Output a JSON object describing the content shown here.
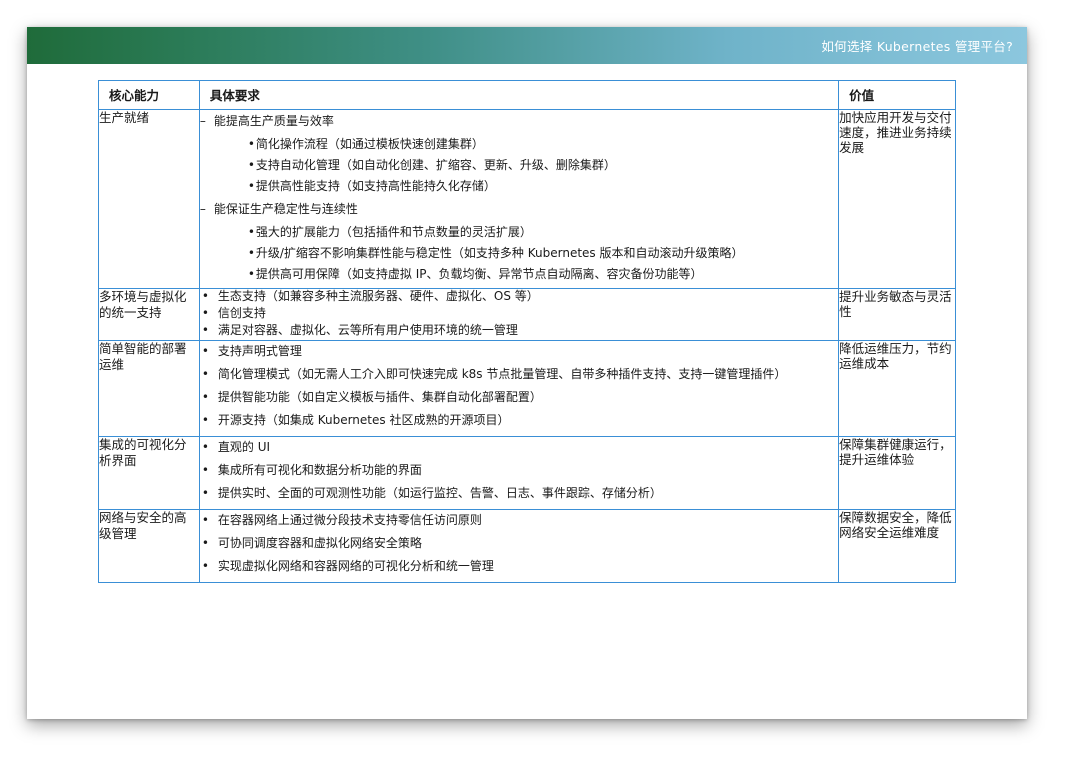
{
  "header": {
    "title": "如何选择 Kubernetes 管理平台?"
  },
  "table": {
    "columns": [
      "核心能力",
      "具体要求",
      "价值"
    ],
    "markers": {
      "dash": "–",
      "bullet": "•"
    },
    "rows": [
      {
        "capability": "生产就绪",
        "groups": [
          {
            "heading": "能提高生产质量与效率",
            "items": [
              "简化操作流程（如通过模板快速创建集群）",
              "支持自动化管理（如自动化创建、扩缩容、更新、升级、删除集群）",
              "提供高性能支持（如支持高性能持久化存储）"
            ]
          },
          {
            "heading": "能保证生产稳定性与连续性",
            "items": [
              "强大的扩展能力（包括插件和节点数量的灵活扩展）",
              "升级/扩缩容不影响集群性能与稳定性（如支持多种 Kubernetes 版本和自动滚动升级策略）",
              "提供高可用保障（如支持虚拟 IP、负载均衡、异常节点自动隔离、容灾备份功能等）"
            ]
          }
        ],
        "value": "加快应用开发与交付速度，推进业务持续发展"
      },
      {
        "capability": "多环境与虚拟化的统一支持",
        "items": [
          "生态支持（如兼容多种主流服务器、硬件、虚拟化、OS 等）",
          "信创支持",
          "满足对容器、虚拟化、云等所有用户使用环境的统一管理"
        ],
        "value": "提升业务敏态与灵活性"
      },
      {
        "capability": "简单智能的部署运维",
        "items": [
          "支持声明式管理",
          "简化管理模式（如无需人工介入即可快速完成 k8s 节点批量管理、自带多种插件支持、支持一键管理插件）",
          "提供智能功能（如自定义模板与插件、集群自动化部署配置）",
          "开源支持（如集成 Kubernetes 社区成熟的开源项目）"
        ],
        "value": "降低运维压力，节约运维成本"
      },
      {
        "capability": "集成的可视化分析界面",
        "items": [
          "直观的 UI",
          "集成所有可视化和数据分析功能的界面",
          "提供实时、全面的可观测性功能（如运行监控、告警、日志、事件跟踪、存储分析）"
        ],
        "value": "保障集群健康运行，提升运维体验"
      },
      {
        "capability": "网络与安全的高级管理",
        "items": [
          "在容器网络上通过微分段技术支持零信任访问原则",
          "可协同调度容器和虚拟化网络安全策略",
          "实现虚拟化网络和容器网络的可视化分析和统一管理"
        ],
        "value": "保障数据安全，降低网络安全运维难度"
      }
    ]
  }
}
